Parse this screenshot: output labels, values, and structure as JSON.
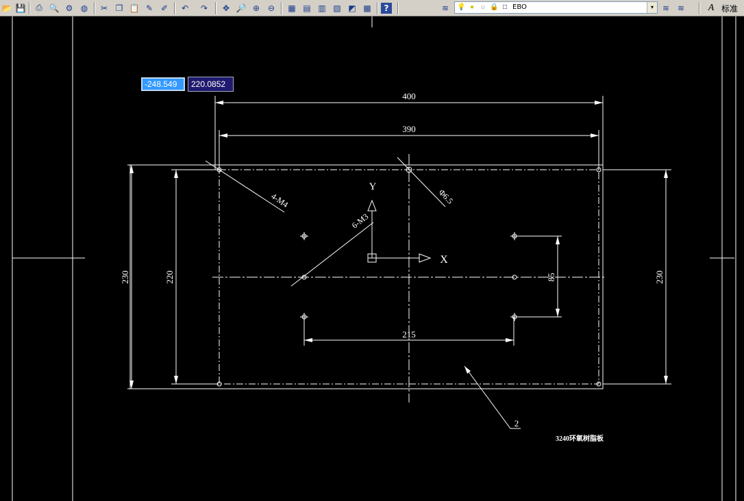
{
  "toolbar": {
    "buttons": [
      {
        "name": "open-icon",
        "glyph": "📂"
      },
      {
        "name": "save-icon",
        "glyph": "💾"
      },
      {
        "name": "print-icon",
        "glyph": "⎙"
      },
      {
        "name": "print-preview-icon",
        "glyph": "🔍"
      },
      {
        "name": "publish-icon",
        "glyph": "⚙"
      },
      {
        "name": "globe-icon",
        "glyph": "◍"
      },
      {
        "name": "cut-icon",
        "glyph": "✂"
      },
      {
        "name": "copy-icon",
        "glyph": "❐"
      },
      {
        "name": "paste-icon",
        "glyph": "📋"
      },
      {
        "name": "match-properties-icon",
        "glyph": "✎"
      },
      {
        "name": "block-editor-icon",
        "glyph": "✐"
      },
      {
        "name": "undo-icon",
        "glyph": "↶"
      },
      {
        "name": "redo-icon",
        "glyph": "↷"
      },
      {
        "name": "pan-icon",
        "glyph": "✥"
      },
      {
        "name": "zoom-realtime-icon",
        "glyph": "🔎"
      },
      {
        "name": "zoom-window-icon",
        "glyph": "⊕"
      },
      {
        "name": "zoom-previous-icon",
        "glyph": "⊖"
      },
      {
        "name": "properties-icon",
        "glyph": "▦"
      },
      {
        "name": "design-center-icon",
        "glyph": "▤"
      },
      {
        "name": "tool-palettes-icon",
        "glyph": "▥"
      },
      {
        "name": "sheet-set-icon",
        "glyph": "▧"
      },
      {
        "name": "markup-icon",
        "glyph": "◩"
      },
      {
        "name": "calculator-icon",
        "glyph": "▩"
      },
      {
        "name": "help-icon",
        "glyph": "?"
      },
      {
        "name": "layer-manager-icon",
        "glyph": "≋"
      }
    ],
    "layer": {
      "name": "EBO",
      "dropdown_glyph": "▾",
      "icons": [
        "💡",
        "●",
        "☼",
        "🔒",
        "□"
      ]
    },
    "layer_state_icons": [
      "≋",
      "≋"
    ],
    "text_style_glyph": "A",
    "text_style_label": "标准"
  },
  "coordinate_input": {
    "x_value": "-248.549",
    "y_value": "220.0852"
  },
  "drawing": {
    "colors": {
      "background": "#000000",
      "lines": "#ffffff"
    },
    "dimensions": {
      "outer_width": "400",
      "inner_width": "390",
      "hole_spacing": "215",
      "outer_height": "230",
      "inner_height": "220",
      "right_height": "230",
      "vertical_spacing": "85",
      "hole_4": "4-M4",
      "hole_6": "6-M3",
      "diameter": "Φ6.5"
    },
    "ucs": {
      "y_label": "Y",
      "x_label": "X"
    },
    "balloon": "2",
    "caption": "3240环氧树脂板"
  }
}
